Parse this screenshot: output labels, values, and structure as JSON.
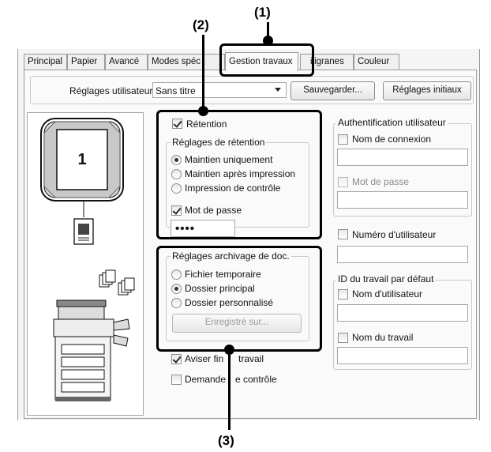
{
  "callouts": {
    "c1": "(1)",
    "c2": "(2)",
    "c3": "(3)"
  },
  "tabs": [
    {
      "label": "Principal"
    },
    {
      "label": "Papier"
    },
    {
      "label": "Avancé"
    },
    {
      "label": "Modes spéc"
    },
    {
      "label": "Gestion travaux"
    },
    {
      "label": "iligranes"
    },
    {
      "label": "Couleur"
    }
  ],
  "user_settings": {
    "label": "Réglages utilisateur:",
    "value": "Sans titre",
    "save_button": "Sauvegarder...",
    "initial_button": "Réglages initiaux"
  },
  "preview": {
    "page_number": "1"
  },
  "retention": {
    "checkbox_label": "Rétention",
    "checked": true,
    "group_label": "Réglages de rétention",
    "options": [
      "Maintien uniquement",
      "Maintien après impression",
      "Impression de contrôle"
    ],
    "selected": "Maintien uniquement",
    "password_label": "Mot de passe",
    "password_checked": true,
    "password_value": "••••"
  },
  "archive": {
    "group_label": "Réglages archivage de doc.",
    "options": [
      "Fichier temporaire",
      "Dossier principal",
      "Dossier personnalisé"
    ],
    "selected": "Dossier principal",
    "stored_button": "Enregistré sur..."
  },
  "notify_end": {
    "label_a": "Aviser fin",
    "label_b": "travail",
    "checked": true
  },
  "confirm_request": {
    "label_a": "Demande",
    "label_b": "e contrôle",
    "checked": false
  },
  "auth": {
    "group_label": "Authentification utilisateur",
    "login_label": "Nom de connexion",
    "password_label": "Mot de passe",
    "user_number_label": "Numéro d'utilisateur"
  },
  "job_id": {
    "group_label": "ID du travail par défaut",
    "user_name_label": "Nom d'utilisateur",
    "job_name_label": "Nom du travail"
  },
  "colors": {
    "highlight": "#000000",
    "panel": "#fafafa",
    "border": "#9a9a9a"
  }
}
